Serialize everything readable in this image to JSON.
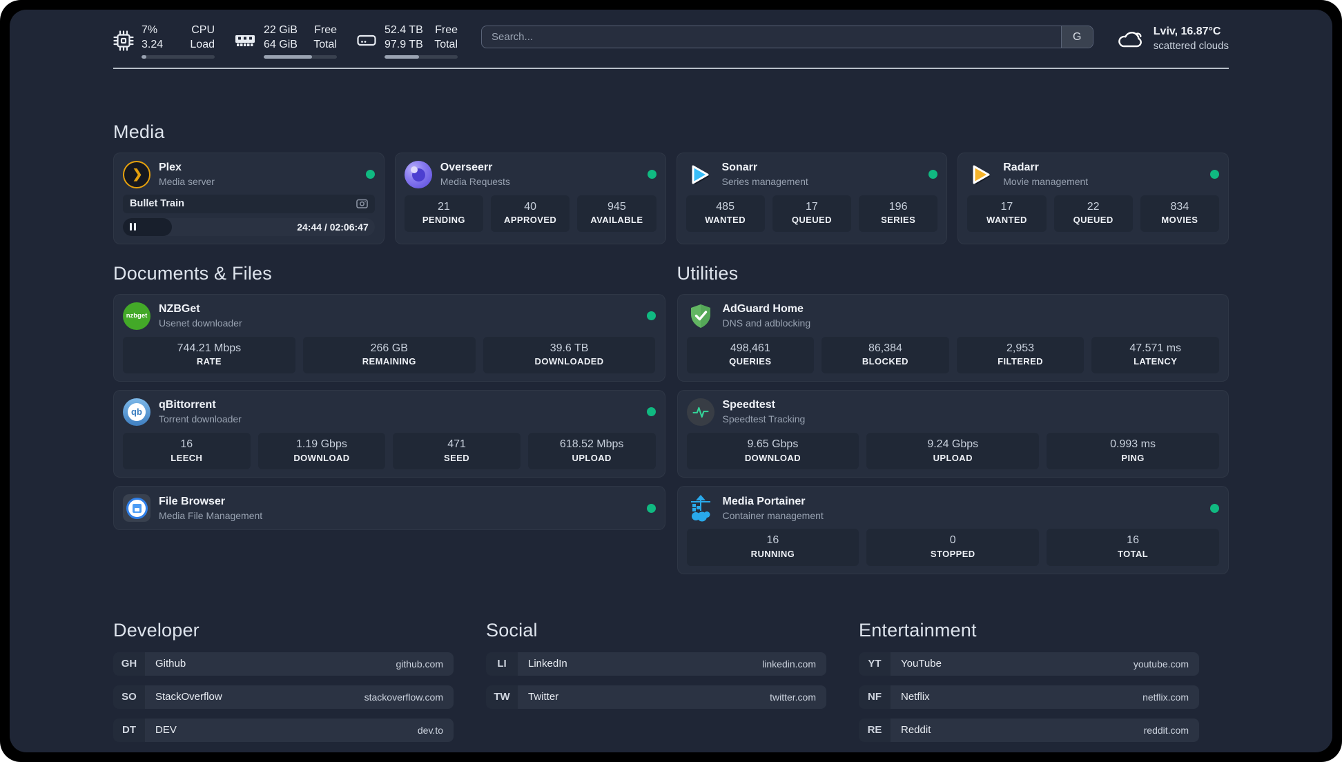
{
  "colors": {
    "page_bg": "#1f2636",
    "card_bg": "#262e3e",
    "inner_box_bg": "#202836",
    "status_online": "#10b981",
    "divider": "#ced5de",
    "plex_accent": "#e5a00d",
    "overseerr_accent": "#6456e8",
    "sonarr_accent": "#38bdf8",
    "radarr_accent": "#f5b32a",
    "nzbget_accent": "#43a928",
    "qbittorrent_accent": "#4695d3",
    "filebrowser_accent": "#2f7fe8",
    "adguard_accent": "#63b663",
    "speedtest_accent": "#34d399",
    "portainer_accent": "#29a9eb"
  },
  "topbar": {
    "widgets": [
      {
        "icon": "cpu-icon",
        "value_top": "7%",
        "value_bottom": "3.24",
        "label_top": "CPU",
        "label_bottom": "Load",
        "progress_percent": 7
      },
      {
        "icon": "memory-icon",
        "value_top": "22 GiB",
        "value_bottom": "64 GiB",
        "label_top": "Free",
        "label_bottom": "Total",
        "progress_percent": 66
      },
      {
        "icon": "disk-icon",
        "value_top": "52.4 TB",
        "value_bottom": "97.9 TB",
        "label_top": "Free",
        "label_bottom": "Total",
        "progress_percent": 47
      }
    ],
    "search": {
      "placeholder": "Search...",
      "provider_button_label": "G"
    },
    "weather": {
      "icon": "cloud-icon",
      "location_temperature": "Lviv, 16.87°C",
      "condition": "scattered clouds"
    }
  },
  "sections": {
    "media": {
      "heading": "Media",
      "plex": {
        "name": "Plex",
        "description": "Media server",
        "icon": "plex-icon",
        "online": true,
        "now_playing": {
          "title": "Bullet Train",
          "media_icon": "camera-icon",
          "state": "paused",
          "time": "24:44 / 02:06:47",
          "progress_percent": 19.5
        }
      },
      "overseerr": {
        "name": "Overseerr",
        "description": "Media Requests",
        "icon": "overseerr-icon",
        "online": true,
        "stats": [
          {
            "value": "21",
            "label": "PENDING"
          },
          {
            "value": "40",
            "label": "APPROVED"
          },
          {
            "value": "945",
            "label": "AVAILABLE"
          }
        ]
      },
      "sonarr": {
        "name": "Sonarr",
        "description": "Series management",
        "icon": "sonarr-icon",
        "online": true,
        "stats": [
          {
            "value": "485",
            "label": "WANTED"
          },
          {
            "value": "17",
            "label": "QUEUED"
          },
          {
            "value": "196",
            "label": "SERIES"
          }
        ]
      },
      "radarr": {
        "name": "Radarr",
        "description": "Movie management",
        "icon": "radarr-icon",
        "online": true,
        "stats": [
          {
            "value": "17",
            "label": "WANTED"
          },
          {
            "value": "22",
            "label": "QUEUED"
          },
          {
            "value": "834",
            "label": "MOVIES"
          }
        ]
      }
    },
    "documents": {
      "heading": "Documents & Files",
      "nzbget": {
        "name": "NZBGet",
        "description": "Usenet downloader",
        "icon": "nzbget-icon",
        "online": true,
        "stats": [
          {
            "value": "744.21 Mbps",
            "label": "RATE"
          },
          {
            "value": "266 GB",
            "label": "REMAINING"
          },
          {
            "value": "39.6 TB",
            "label": "DOWNLOADED"
          }
        ]
      },
      "qbittorrent": {
        "name": "qBittorrent",
        "description": "Torrent downloader",
        "icon": "qbittorrent-icon",
        "online": true,
        "stats": [
          {
            "value": "16",
            "label": "LEECH"
          },
          {
            "value": "1.19 Gbps",
            "label": "DOWNLOAD"
          },
          {
            "value": "471",
            "label": "SEED"
          },
          {
            "value": "618.52 Mbps",
            "label": "UPLOAD"
          }
        ]
      },
      "filebrowser": {
        "name": "File Browser",
        "description": "Media File Management",
        "icon": "filebrowser-icon",
        "online": true
      }
    },
    "utilities": {
      "heading": "Utilities",
      "adguard": {
        "name": "AdGuard Home",
        "description": "DNS and adblocking",
        "icon": "adguard-icon",
        "online": false,
        "stats": [
          {
            "value": "498,461",
            "label": "QUERIES"
          },
          {
            "value": "86,384",
            "label": "BLOCKED"
          },
          {
            "value": "2,953",
            "label": "FILTERED"
          },
          {
            "value": "47.571 ms",
            "label": "LATENCY"
          }
        ]
      },
      "speedtest": {
        "name": "Speedtest",
        "description": "Speedtest Tracking",
        "icon": "speedtest-icon",
        "online": false,
        "stats": [
          {
            "value": "9.65 Gbps",
            "label": "DOWNLOAD"
          },
          {
            "value": "9.24 Gbps",
            "label": "UPLOAD"
          },
          {
            "value": "0.993 ms",
            "label": "PING"
          }
        ]
      },
      "portainer": {
        "name": "Media Portainer",
        "description": "Container management",
        "icon": "portainer-icon",
        "online": true,
        "stats": [
          {
            "value": "16",
            "label": "RUNNING"
          },
          {
            "value": "0",
            "label": "STOPPED"
          },
          {
            "value": "16",
            "label": "TOTAL"
          }
        ]
      }
    }
  },
  "bookmarks": {
    "developer": {
      "heading": "Developer",
      "items": [
        {
          "abbr": "GH",
          "name": "Github",
          "url": "github.com"
        },
        {
          "abbr": "SO",
          "name": "StackOverflow",
          "url": "stackoverflow.com"
        },
        {
          "abbr": "DT",
          "name": "DEV",
          "url": "dev.to"
        }
      ]
    },
    "social": {
      "heading": "Social",
      "items": [
        {
          "abbr": "LI",
          "name": "LinkedIn",
          "url": "linkedin.com"
        },
        {
          "abbr": "TW",
          "name": "Twitter",
          "url": "twitter.com"
        }
      ]
    },
    "entertainment": {
      "heading": "Entertainment",
      "items": [
        {
          "abbr": "YT",
          "name": "YouTube",
          "url": "youtube.com"
        },
        {
          "abbr": "NF",
          "name": "Netflix",
          "url": "netflix.com"
        },
        {
          "abbr": "RE",
          "name": "Reddit",
          "url": "reddit.com"
        }
      ]
    }
  }
}
